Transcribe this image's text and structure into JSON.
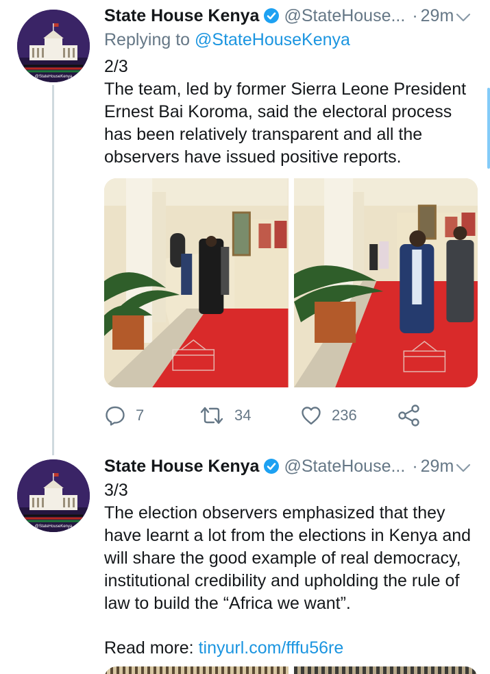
{
  "colors": {
    "link": "#1b95e0",
    "secondary_text": "#657786",
    "primary_text": "#14171a",
    "verified": "#1da1f2",
    "thread_line": "#cfd9de"
  },
  "tweets": [
    {
      "author_name": "State House Kenya",
      "author_handle": "@StateHouse...",
      "separator": "·",
      "time": "29m",
      "avatar_caption": "@StateHouseKenya",
      "reply_prefix": "Replying to ",
      "reply_handle": "@StateHouseKenya",
      "counter": "2/3",
      "text": "The team, led by former Sierra Leone President Ernest Bai Koroma, said the electoral process has been relatively transparent and all the observers have issued positive reports.",
      "media_count": 2,
      "actions": {
        "reply_icon": "reply-icon",
        "replies": "7",
        "retweet_icon": "retweet-icon",
        "retweets": "34",
        "like_icon": "heart-icon",
        "likes": "236",
        "share_icon": "share-icon"
      }
    },
    {
      "author_name": "State House Kenya",
      "author_handle": "@StateHouse...",
      "separator": "·",
      "time": "29m",
      "avatar_caption": "@StateHouseKenya",
      "counter": "3/3",
      "text": "The election observers emphasized that they have learnt a lot from the elections in Kenya and will share the good example of real democracy, institutional credibility and upholding the rule of law to build the “Africa we want”.",
      "read_more_label": "Read more: ",
      "read_more_link": "tinyurl.com/fffu56re"
    }
  ]
}
